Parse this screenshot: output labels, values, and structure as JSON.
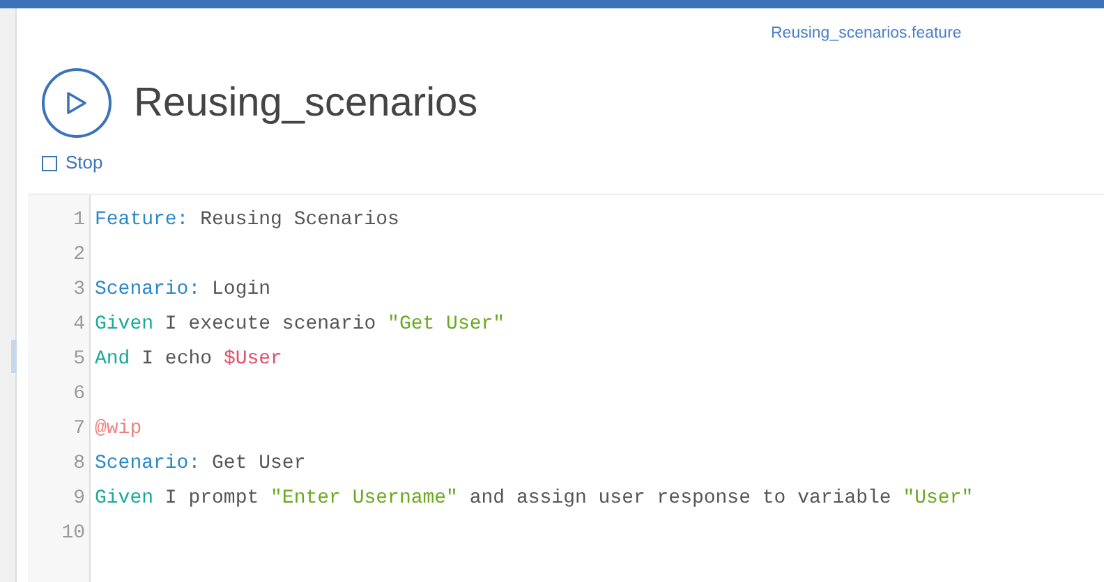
{
  "file_link": "Reusing_scenarios.feature",
  "title": "Reusing_scenarios",
  "stop_link": "Stop",
  "editor": {
    "lines": [
      {
        "number": "1",
        "tokens": [
          {
            "kind": "keyword",
            "text": "Feature:"
          },
          {
            "kind": "text",
            "text": " Reusing Scenarios"
          }
        ]
      },
      {
        "number": "2"
      },
      {
        "number": "3",
        "tokens": [
          {
            "kind": "keyword",
            "text": "Scenario:"
          },
          {
            "kind": "text",
            "text": " Login"
          }
        ]
      },
      {
        "number": "4",
        "tokens": [
          {
            "kind": "step",
            "text": "Given"
          },
          {
            "kind": "text",
            "text": " I execute scenario "
          },
          {
            "kind": "string",
            "text": "\"Get User\""
          }
        ]
      },
      {
        "number": "5",
        "tokens": [
          {
            "kind": "step",
            "text": "And"
          },
          {
            "kind": "text",
            "text": " I echo "
          },
          {
            "kind": "variable",
            "text": "$User"
          }
        ]
      },
      {
        "number": "6"
      },
      {
        "number": "7",
        "tokens": [
          {
            "kind": "tag",
            "text": "@wip"
          }
        ]
      },
      {
        "number": "8",
        "tokens": [
          {
            "kind": "keyword",
            "text": "Scenario:"
          },
          {
            "kind": "text",
            "text": " Get User"
          }
        ]
      },
      {
        "number": "9",
        "tokens": [
          {
            "kind": "step",
            "text": "Given"
          },
          {
            "kind": "text",
            "text": " I prompt "
          },
          {
            "kind": "string",
            "text": "\"Enter Username\""
          },
          {
            "kind": "text",
            "text": " and assign user response to variable "
          },
          {
            "kind": "string",
            "text": "\"User\""
          }
        ]
      },
      {
        "number": "10"
      }
    ]
  }
}
